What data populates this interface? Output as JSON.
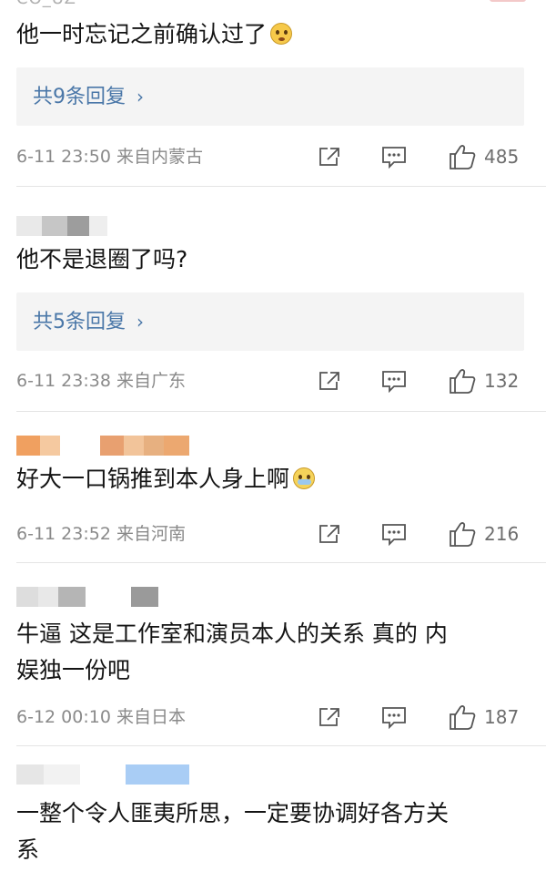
{
  "page": {
    "top_cut_name": "CO_UZ"
  },
  "comments": [
    {
      "text": "他一时忘记之前确认过了",
      "emoji": "thinking-face",
      "replies_label": "共9条回复",
      "time": "6-11 23:50",
      "location": "来自内蒙古",
      "likes": "485"
    },
    {
      "text": "他不是退圈了吗?",
      "replies_label": "共5条回复",
      "time": "6-11 23:38",
      "location": "来自广东",
      "likes": "132",
      "name_mosaic_colors": [
        "#e9e9e9",
        "#9d9d9d",
        "#c6c6c6",
        "#eeeeee"
      ]
    },
    {
      "text": "好大一口锅推到本人身上啊",
      "emoji": "facepalm-face",
      "time": "6-11 23:52",
      "location": "来自河南",
      "likes": "216",
      "name_mosaic_colors": [
        "#f0a060",
        "#ffffff",
        "#e8a070",
        "#f5c9a0",
        "#e7b080"
      ]
    },
    {
      "text": "牛逼 这是工作室和演员本人的关系 真的 内\n娱独一份吧",
      "time": "6-12 00:10",
      "location": "来自日本",
      "likes": "187",
      "name_mosaic_colors": [
        "#dddddd",
        "#b5b5b5",
        "#e8e8e8",
        "#ffffff",
        "#9a9a9a"
      ]
    },
    {
      "text": "一整个令人匪夷所思，一定要协调好各方关\n系",
      "name_mosaic_colors": [
        "#e6e6e6",
        "#f2f2f2",
        "#ffffff",
        "#a9cdf5"
      ]
    }
  ],
  "colors": {
    "link": "#4a77a8",
    "meta": "#8a8a8a",
    "reply_bg": "#f4f4f4"
  },
  "icons": {
    "share": "share-icon",
    "comment": "comment-icon",
    "like": "thumbs-up-icon"
  }
}
